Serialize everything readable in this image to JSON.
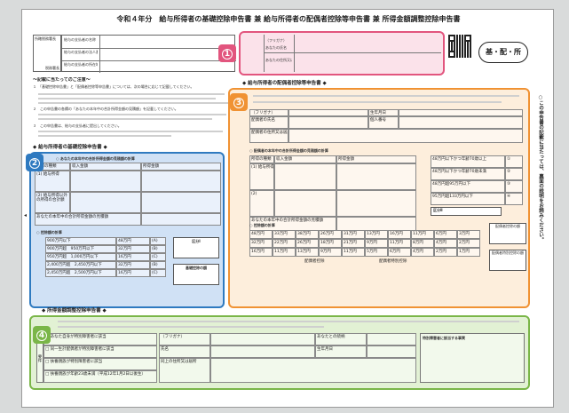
{
  "document": {
    "title": "令和４年分　給与所得者の基礎控除申告書 兼 給与所得者の配偶者控除等申告書 兼 所得金額調整控除申告書",
    "stamp_label": "基・配・所"
  },
  "header": {
    "tax_office_label": "所轄税務署長",
    "tax_office_sub": "税務署長",
    "payer_fields": [
      "給与の支払者の名称（氏名）",
      "給与の支払者の法人番号",
      "給与の支払者の所在地（住所）"
    ],
    "employee_fields": [
      "（フリガナ）",
      "あなたの氏名",
      "あなたの住所又は居所"
    ]
  },
  "notes": {
    "heading": "～記載に当たってのご注意～",
    "items": [
      "１　「基礎控除申告書」と「配偶者控除等申告書」については、次の場合に応じて記載してください。",
      "２　この申告書の各欄の「あなたの本年中の合計所得金額の見積額」を記載してください。",
      "３　この申告書は、給与の支払者に提出してください。"
    ]
  },
  "basic_section": {
    "heading": "◆ 給与所得者の基礎控除申告書 ◆",
    "calc_heading": "○ あなたの本年中の合計所得金額の見積額の計算",
    "columns": [
      "所得の種類",
      "収入金額",
      "所得金額"
    ],
    "rows": [
      "(1) 給与所得",
      "(2) 給与所得以外の所得の合計額"
    ],
    "total_label": "あなたの本年中の合計所得金額の見積額",
    "deduction_heading": "○ 控除額の計算",
    "deduction_rows": [
      {
        "range": "900万円以下",
        "amount": "48万円",
        "mark": "(A)"
      },
      {
        "range": "900万円超　950万円以下",
        "amount": "32万円",
        "mark": "(B)"
      },
      {
        "range": "950万円超　1,000万円以下",
        "amount": "16万円",
        "mark": "(C)"
      },
      {
        "range": "2,400万円超　2,450万円以下",
        "amount": "32万円",
        "mark": "(B)"
      },
      {
        "range": "2,450万円超　2,500万円以下",
        "amount": "16万円",
        "mark": "(C)"
      }
    ],
    "division_label": "区分Ⅰ",
    "basic_deduction_label": "基礎控除の額"
  },
  "spouse_section": {
    "heading": "◆ 給与所得者の配偶者控除等申告書 ◆",
    "fields": [
      "（フリガナ）",
      "配偶者の氏名",
      "生年月日",
      "個人番号",
      "配偶者の住所又は居所"
    ],
    "calc_heading": "○ 配偶者の本年中の合計所得金額の見積額の計算",
    "categories": [
      {
        "label": "48万円以下かつ年齢70歳以上",
        "mark": "①"
      },
      {
        "label": "48万円以下かつ年齢70歳未満",
        "mark": "②"
      },
      {
        "label": "48万円超95万円以下",
        "mark": "③"
      },
      {
        "label": "95万円超133万円以下",
        "mark": "④"
      }
    ],
    "division_label": "区分Ⅱ",
    "deduction_heading": "○ 控除額の計算",
    "deduction_matrix": [
      [
        "48万円",
        "33万円",
        "38万円",
        "26万円",
        "31万円",
        "13万円",
        "16万円",
        "11万円",
        "6万円",
        "3万円"
      ],
      [
        "32万円",
        "22万円",
        "26万円",
        "18万円",
        "21万円",
        "9万円",
        "11万円",
        "8万円",
        "4万円",
        "2万円"
      ],
      [
        "16万円",
        "11万円",
        "13万円",
        "9万円",
        "11万円",
        "5万円",
        "6万円",
        "4万円",
        "2万円",
        "1万円"
      ]
    ],
    "right_labels": [
      "配偶者控除の額",
      "配偶者特別控除の額"
    ],
    "footer_left": "配偶者控除",
    "footer_right": "配偶者特別控除"
  },
  "adjustment_section": {
    "heading": "◆ 所得金額調整控除申告書 ◆",
    "requirement_label": "要件",
    "options": [
      "□ あなた自身が特別障害者に該当",
      "□ 同一生計配偶者が特別障害者に該当",
      "□ 扶養親族が特別障害者に該当",
      "□ 扶養親族が年齢23歳未満（平成12年1月2日以後生）"
    ],
    "person_labels": [
      "（フリガナ）",
      "氏名",
      "あなたとの続柄",
      "生年月日",
      "同上の住所又は居所"
    ],
    "right_box": "特別障害者に該当する事実"
  },
  "side_note": "○この申告書の記載に当たっては、裏面の説明をお読みください。",
  "annotations": [
    {
      "number": "1",
      "color": "#e2557e"
    },
    {
      "number": "2",
      "color": "#2f7ac0"
    },
    {
      "number": "3",
      "color": "#f09233"
    },
    {
      "number": "4",
      "color": "#7ab648"
    }
  ]
}
